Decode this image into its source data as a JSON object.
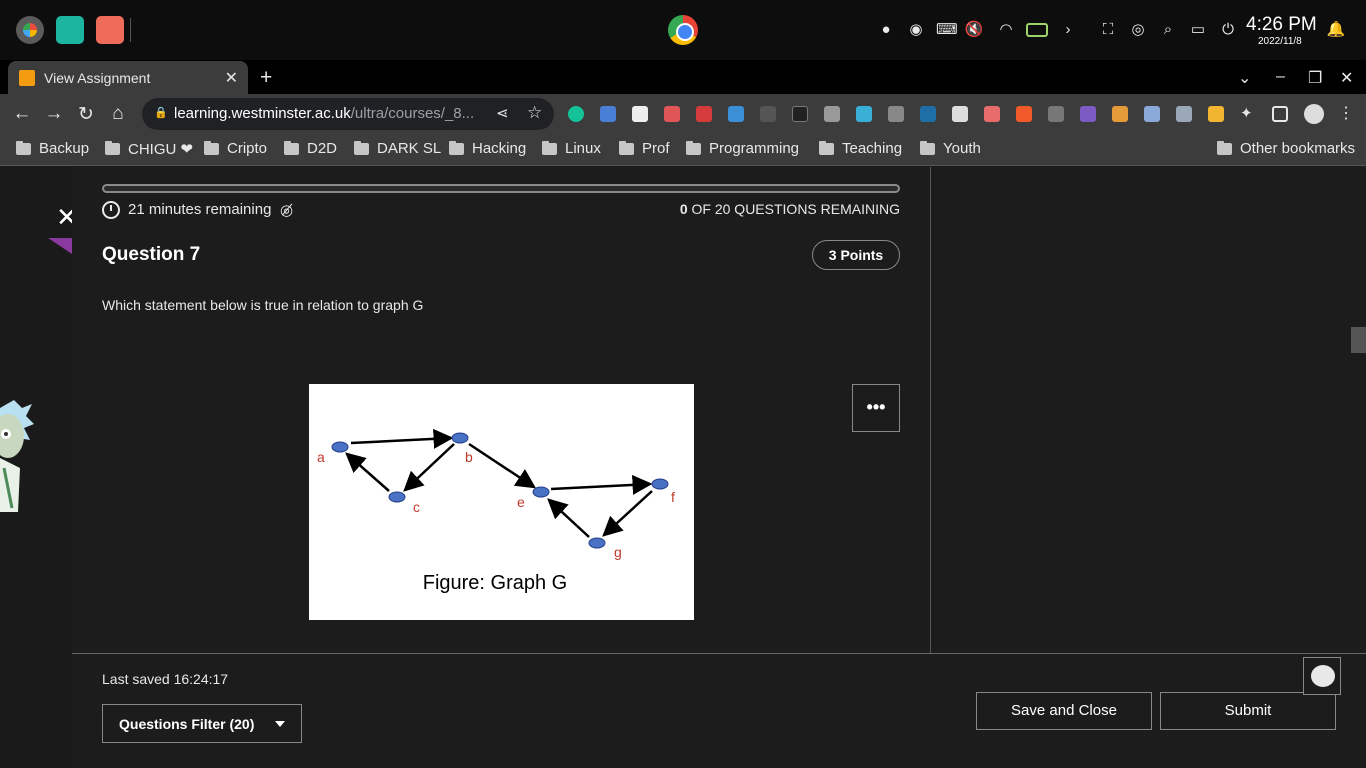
{
  "os": {
    "clock": "4:26 PM",
    "date": "2022/11/8"
  },
  "browser": {
    "tab_title": "View Assignment",
    "url_host": "learning.westminster.ac.uk",
    "url_path": "/ultra/courses/_8...",
    "bookmarks": [
      "Backup",
      "CHIGU ❤",
      "Cripto",
      "D2D",
      "DARK SL",
      "Hacking",
      "Linux",
      "Prof",
      "Programming",
      "Teaching",
      "Youth"
    ],
    "other_bookmarks": "Other bookmarks"
  },
  "assignment": {
    "timer": "21 minutes remaining",
    "remaining_count": "0",
    "remaining_label": "OF 20 QUESTIONS REMAINING",
    "question_title": "Question 7",
    "points": "3 Points",
    "question_text": "Which statement below is true in relation to graph G",
    "more_label": "•••"
  },
  "figure": {
    "caption": "Figure: Graph G",
    "nodes": [
      "a",
      "b",
      "c",
      "e",
      "f",
      "g"
    ]
  },
  "footer": {
    "last_saved": "Last saved 16:24:17",
    "filter_label": "Questions Filter (20)",
    "save_close": "Save and Close",
    "submit": "Submit"
  },
  "colors": {
    "node_fill": "#4a72c4",
    "node_label": "#c0392b",
    "accent_flag": "#8a3a9e"
  }
}
